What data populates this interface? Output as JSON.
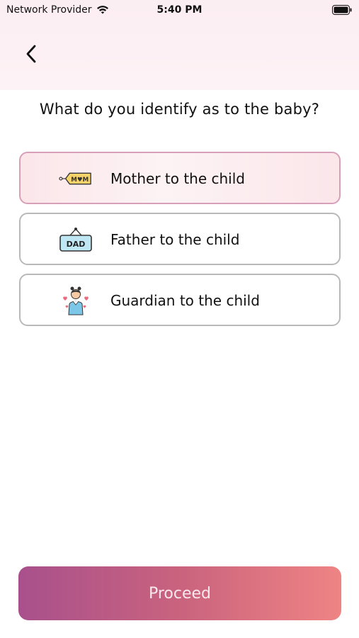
{
  "status_bar": {
    "carrier": "Network Provider",
    "time": "5:40 PM",
    "wifi_icon": "wifi-icon",
    "battery_icon": "battery-icon"
  },
  "header": {
    "back_icon": "chevron-left-icon"
  },
  "question": "What do you identify as to the baby?",
  "options": [
    {
      "label": "Mother to the child",
      "icon": "mom-tag-icon",
      "icon_text": "M♥M",
      "selected": true
    },
    {
      "label": "Father to the child",
      "icon": "dad-sign-icon",
      "icon_text": "DAD",
      "selected": false
    },
    {
      "label": "Guardian to the child",
      "icon": "guardian-icon",
      "selected": false
    }
  ],
  "proceed": {
    "label": "Proceed"
  },
  "colors": {
    "accent_start": "#a9508c",
    "accent_end": "#ef8484",
    "selected_bg": "#fbe6ea",
    "selected_border": "#d8a0b8",
    "option_border": "#b9b9b9"
  }
}
